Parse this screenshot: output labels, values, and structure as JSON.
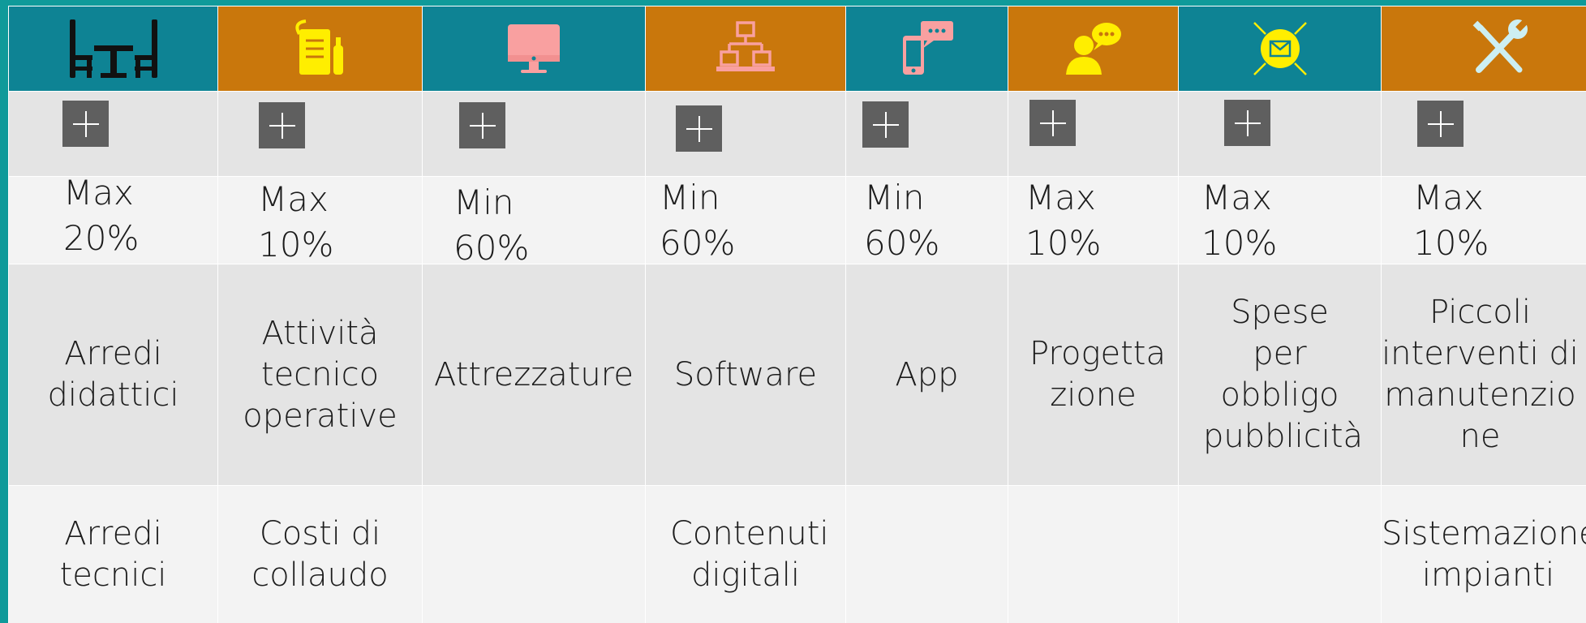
{
  "columns": [
    {
      "icon": "classroom-furniture-icon",
      "header_color": "#0e8394",
      "icon_color": "#111111",
      "limit_line1": "Max",
      "limit_line2": "20%",
      "category": "Arredi didattici",
      "extra": "Arredi tecnici"
    },
    {
      "icon": "tools-checklist-icon",
      "header_color": "#c9770c",
      "icon_color": "#ffee00",
      "limit_line1": "Max",
      "limit_line2": "10%",
      "category": "Attività tecnico operative",
      "extra": "Costi di collaudo"
    },
    {
      "icon": "desktop-monitor-icon",
      "header_color": "#0e8394",
      "icon_color": "#f9a0a0",
      "limit_line1": "Min",
      "limit_line2": "60%",
      "category": "Attrezzature",
      "extra": ""
    },
    {
      "icon": "network-hierarchy-icon",
      "header_color": "#c9770c",
      "icon_color": "#f9a0a0",
      "limit_line1": "Min",
      "limit_line2": "60%",
      "category": "Software",
      "extra": "Contenuti digitali"
    },
    {
      "icon": "mobile-chat-icon",
      "header_color": "#0e8394",
      "icon_color": "#f9a0a0",
      "limit_line1": "Min",
      "limit_line2": "60%",
      "category": "App",
      "extra": ""
    },
    {
      "icon": "person-speech-icon",
      "header_color": "#c9770c",
      "icon_color": "#ffee00",
      "limit_line1": "Max",
      "limit_line2": "10%",
      "category": "Progetta zione",
      "extra": ""
    },
    {
      "icon": "mail-broadcast-icon",
      "header_color": "#0e8394",
      "icon_color": "#ffee00",
      "limit_line1": "Max",
      "limit_line2": "10%",
      "category": "Spese per obbligo pubblicità",
      "extra": ""
    },
    {
      "icon": "wrench-screwdriver-icon",
      "header_color": "#c9770c",
      "icon_color": "#cdeff2",
      "limit_line1": "Max",
      "limit_line2": "10%",
      "category": "Piccoli interventi di manutenzio ne",
      "extra": "Sistemazione impianti"
    }
  ],
  "colors": {
    "teal": "#0e8394",
    "orange": "#c9770c",
    "background": "#0f9a9a",
    "button": "#5f5f5f"
  }
}
